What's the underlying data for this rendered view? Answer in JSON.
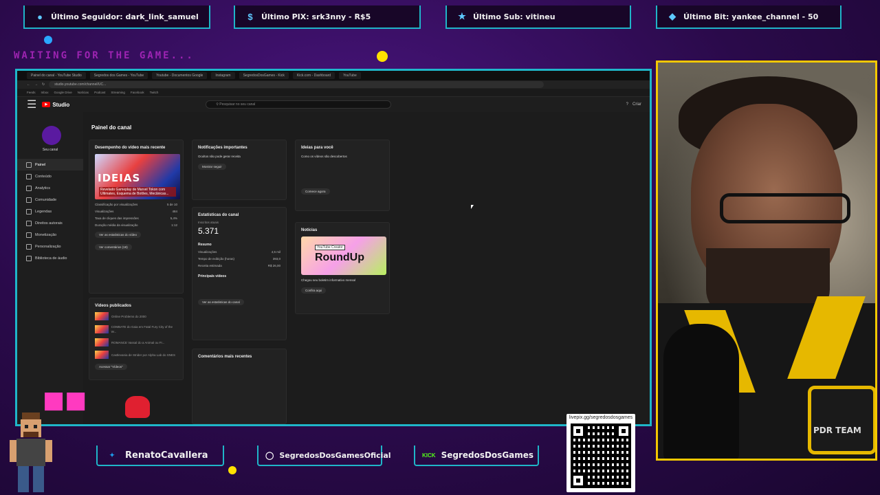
{
  "alerts": [
    {
      "icon": "user-icon",
      "label": "Último Seguidor: dark_link_samuel"
    },
    {
      "icon": "dollar-icon",
      "label": "Último PIX: srk3nny - R$5"
    },
    {
      "icon": "star-icon",
      "label": "Último Sub: vitineu"
    },
    {
      "icon": "diamond-icon",
      "label": "Último Bit: yankee_channel - 50"
    }
  ],
  "waiting_text": "WAITING FOR THE GAME...",
  "browser": {
    "url": "studio.youtube.com/channel/UC...",
    "studio_label": "Studio",
    "search_placeholder": "Pesquisar no seu canal",
    "create_label": "Criar"
  },
  "sidebar": {
    "channel_name": "Seu canal",
    "items": [
      "Painel",
      "Conteúdo",
      "Analytics",
      "Comunidade",
      "Legendas",
      "Direitos autorais",
      "Monetização",
      "Personalização",
      "Biblioteca de áudio"
    ]
  },
  "dashboard": {
    "title": "Painel do canal",
    "latest_video": {
      "title": "Desempenho do vídeo mais recente",
      "thumb_word": "IDEIAS",
      "caption": "Revelado Gameplay de Marvel Tokon com Ultimates, Esquema de Botões, Mecânicas...",
      "rows": [
        {
          "k": "Classificação por visualizações",
          "v": "5 de 10"
        },
        {
          "k": "Visualizações",
          "v": "484"
        },
        {
          "k": "Taxa de cliques das impressões",
          "v": "5,4%"
        },
        {
          "k": "Duração média da visualização",
          "v": "1:12"
        }
      ],
      "btn_stats": "Ver as estatísticas do vídeo",
      "btn_comments": "Ver comentários (18)"
    },
    "published": {
      "title": "Vídeos publicados",
      "items": [
        "Online Problems do 2000",
        "COMBATE do Gaia em Fatal Fury City of the W...",
        "ROMANCE Vassal do a Animal ou Fr...",
        "Castlevania de Strider por Alpha Lab do SNES"
      ],
      "btn": "Acessar \"Vídeos\""
    },
    "notifications": {
      "title": "Notificações importantes",
      "subtitle": "Ocultos não pode gerar receita",
      "btn": "Mostrar seguir"
    },
    "stats": {
      "title": "Estatísticas do canal",
      "subs_label": "Inscritos atuais",
      "subs_value": "5.371",
      "summary_title": "Resumo",
      "rows": [
        {
          "k": "Visualizações",
          "v": "4,5 mil"
        },
        {
          "k": "Tempo de exibição (horas)",
          "v": "393,0"
        },
        {
          "k": "Receita estimada",
          "v": "R$ 26,00"
        }
      ],
      "top_title": "Principais vídeos",
      "btn": "Ver as estatísticas do canal"
    },
    "comments": {
      "title": "Comentários mais recentes"
    },
    "ideas": {
      "title": "Ideias para você",
      "subtitle": "Como os vídeos são descobertos",
      "btn": "Comece agora"
    },
    "news": {
      "title": "Notícias",
      "tag": "YouTube Creator",
      "roundup": "RoundUp",
      "subtitle": "Chegou seu boletim informativo mensal",
      "btn": "Confira aqui"
    }
  },
  "socials": [
    {
      "icon": "twitter-icon",
      "label": "RenatoCavallera"
    },
    {
      "icon": "instagram-icon",
      "label": "SegredosDosGamesOficial"
    },
    {
      "icon": "kick-icon",
      "label": "SegredosDosGames",
      "badge": "KICK"
    }
  ],
  "qr": {
    "url": "livepix.gg/segredosdosgames"
  },
  "cam": {
    "logo_text": "PDR TEAM"
  },
  "colors": {
    "accent": "#1fb6c9",
    "cam_border": "#f5c800",
    "bg": "#2a0a4a"
  }
}
